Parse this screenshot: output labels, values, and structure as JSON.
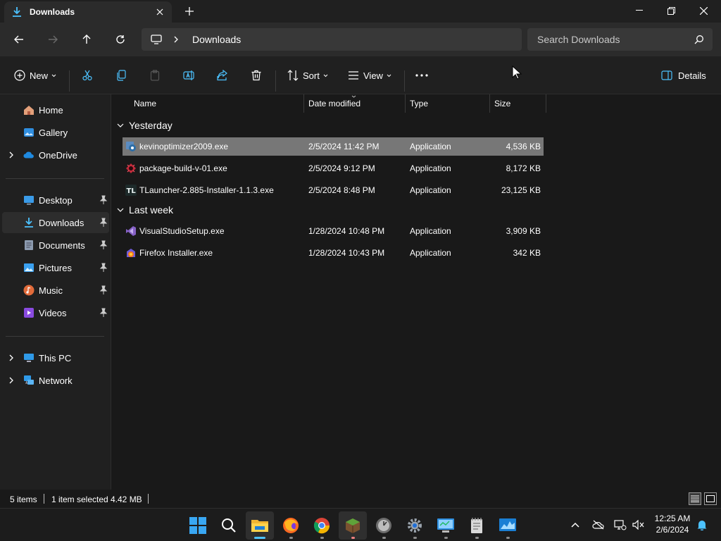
{
  "window": {
    "tab_title": "Downloads"
  },
  "nav": {
    "breadcrumb": "Downloads",
    "search_placeholder": "Search Downloads"
  },
  "commands": {
    "new": "New",
    "sort": "Sort",
    "view": "View",
    "details": "Details"
  },
  "sidebar": {
    "items": [
      {
        "label": "Home",
        "icon": "home-icon"
      },
      {
        "label": "Gallery",
        "icon": "gallery-icon"
      },
      {
        "label": "OneDrive",
        "icon": "onedrive-icon"
      },
      {
        "label": "Desktop",
        "icon": "desktop-icon"
      },
      {
        "label": "Downloads",
        "icon": "downloads-icon"
      },
      {
        "label": "Documents",
        "icon": "documents-icon"
      },
      {
        "label": "Pictures",
        "icon": "pictures-icon"
      },
      {
        "label": "Music",
        "icon": "music-icon"
      },
      {
        "label": "Videos",
        "icon": "videos-icon"
      },
      {
        "label": "This PC",
        "icon": "this-pc-icon"
      },
      {
        "label": "Network",
        "icon": "network-icon"
      }
    ]
  },
  "columns": {
    "name": "Name",
    "date": "Date modified",
    "type": "Type",
    "size": "Size"
  },
  "groups": {
    "yesterday": "Yesterday",
    "last_week": "Last week"
  },
  "files": [
    {
      "name": "kevinoptimizer2009.exe",
      "date": "2/5/2024 11:42 PM",
      "type": "Application",
      "size": "4,536 KB"
    },
    {
      "name": "package-build-v-01.exe",
      "date": "2/5/2024 9:12 PM",
      "type": "Application",
      "size": "8,172 KB"
    },
    {
      "name": "TLauncher-2.885-Installer-1.1.3.exe",
      "date": "2/5/2024 8:48 PM",
      "type": "Application",
      "size": "23,125 KB"
    },
    {
      "name": "VisualStudioSetup.exe",
      "date": "1/28/2024 10:48 PM",
      "type": "Application",
      "size": "3,909 KB"
    },
    {
      "name": "Firefox Installer.exe",
      "date": "1/28/2024 10:43 PM",
      "type": "Application",
      "size": "342 KB"
    }
  ],
  "status": {
    "count": "5 items",
    "selection": "1 item selected",
    "selection_size": "4.42 MB"
  },
  "clock": {
    "time": "12:25 AM",
    "date": "2/6/2024"
  },
  "colors": {
    "accent": "#4cc2ff",
    "selected_row": "#777777",
    "background": "#191919"
  }
}
